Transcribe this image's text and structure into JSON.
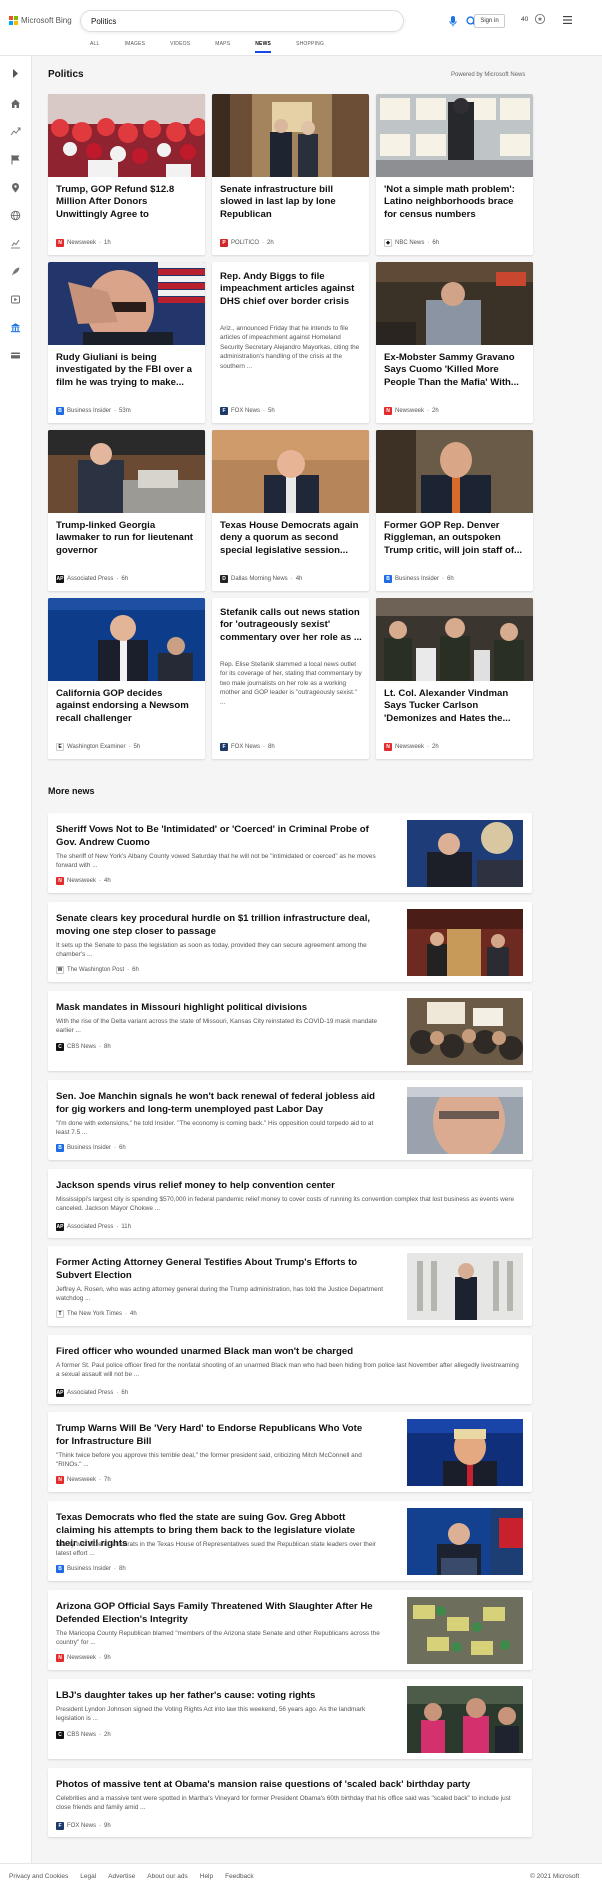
{
  "header": {
    "brand": "Microsoft Bing",
    "query": "Politics",
    "signin": "Sign in",
    "points": "40"
  },
  "nav": [
    "ALL",
    "IMAGES",
    "VIDEOS",
    "MAPS",
    "NEWS",
    "SHOPPING"
  ],
  "nav_active": "NEWS",
  "section": {
    "title": "Politics",
    "powered": "Powered by Microsoft News"
  },
  "cards": [
    {
      "title": "Trump, GOP Refund $12.8 Million After Donors Unwittingly Agree to Recurrin...",
      "source": "Newsweek",
      "time": "1h",
      "desc": ""
    },
    {
      "title": "Senate infrastructure bill slowed in last lap by lone Republican",
      "source": "POLITICO",
      "time": "2h",
      "desc": ""
    },
    {
      "title": "'Not a simple math problem': Latino neighborhoods brace for census numbers",
      "source": "NBC News",
      "time": "6h",
      "desc": ""
    },
    {
      "title": "Rudy Giuliani is being investigated by the FBI over a film he was trying to make...",
      "source": "Business Insider",
      "time": "53m",
      "desc": ""
    },
    {
      "title": "Rep. Andy Biggs to file impeachment articles against DHS chief over border crisis",
      "source": "FOX News",
      "time": "5h",
      "desc": "Ariz., announced Friday that he intends to file articles of impeachment against Homeland Security Secretary Alejandro Mayorkas, citing the administration's handling of the crisis at the southern ..."
    },
    {
      "title": "Ex-Mobster Sammy Gravano Says Cuomo 'Killed More People Than the Mafia' With...",
      "source": "Newsweek",
      "time": "2h",
      "desc": ""
    },
    {
      "title": "Trump-linked Georgia lawmaker to run for lieutenant governor",
      "source": "Associated Press",
      "time": "6h",
      "desc": ""
    },
    {
      "title": "Texas House Democrats again deny a quorum as second special legislative session...",
      "source": "Dallas Morning News",
      "time": "4h",
      "desc": ""
    },
    {
      "title": "Former GOP Rep. Denver Riggleman, an outspoken Trump critic, will join staff of...",
      "source": "Business Insider",
      "time": "6h",
      "desc": ""
    },
    {
      "title": "California GOP decides against endorsing a Newsom recall challenger",
      "source": "Washington Examiner",
      "time": "5h",
      "desc": ""
    },
    {
      "title": "Stefanik calls out news station for 'outrageously sexist' commentary over her role as ...",
      "source": "FOX News",
      "time": "8h",
      "desc": "Rep. Elise Stefanik slammed a local news outlet for its coverage of her, stating that commentary by two male journalists on her role as a working mother and GOP leader is \"outrageously sexist.\" ..."
    },
    {
      "title": "Lt. Col. Alexander Vindman Says Tucker Carlson 'Demonizes and Hates the...",
      "source": "Newsweek",
      "time": "2h",
      "desc": ""
    }
  ],
  "more_news_title": "More news",
  "more_news": [
    {
      "title": "Sheriff Vows Not to Be 'Intimidated' or 'Coerced' in Criminal Probe of Gov. Andrew Cuomo",
      "desc": "The sheriff of New York's Albany County vowed Saturday that he will not be \"intimidated or coerced\" as he moves forward with ...",
      "source": "Newsweek",
      "time": "4h"
    },
    {
      "title": "Senate clears key procedural hurdle on $1 trillion infrastructure deal, moving one step closer to passage",
      "desc": "It sets up the Senate to pass the legislation as soon as today, provided they can secure agreement among the chamber's ...",
      "source": "The Washington Post",
      "time": "6h"
    },
    {
      "title": "Mask mandates in Missouri highlight political divisions",
      "desc": "With the rise of the Delta variant across the state of Missouri, Kansas City reinstated its COVID-19 mask mandate earlier ...",
      "source": "CBS News",
      "time": "8h"
    },
    {
      "title": "Sen. Joe Manchin signals he won't back renewal of federal jobless aid for gig workers and long-term unemployed past Labor Day",
      "desc": "\"I'm done with extensions,\" he told Insider. \"The economy is coming back.\" His opposition could torpedo aid to at least 7.5 ...",
      "source": "Business Insider",
      "time": "6h"
    },
    {
      "title": "Jackson spends virus relief money to help convention center",
      "desc": "Mississippi's largest city is spending $570,000 in federal pandemic relief money to cover costs of running its convention complex that lost business as events were canceled. Jackson Mayor Chokwe ...",
      "source": "Associated Press",
      "time": "11h"
    },
    {
      "title": "Former Acting Attorney General Testifies About Trump's Efforts to Subvert Election",
      "desc": "Jeffrey A. Rosen, who was acting attorney general during the Trump administration, has told the Justice Department watchdog ...",
      "source": "The New York Times",
      "time": "4h"
    },
    {
      "title": "Fired officer who wounded unarmed Black man won't be charged",
      "desc": "A former St. Paul police officer fired for the nonfatal shooting of an unarmed Black man who had been hiding from police last November after allegedly livestreaming a sexual assault will not be ...",
      "source": "Associated Press",
      "time": "6h"
    },
    {
      "title": "Trump Warns Will Be 'Very Hard' to Endorse Republicans Who Vote for Infrastructure Bill",
      "desc": "\"Think twice before you approve this terrible deal,\" the former president said, criticizing Mitch McConnell and \"RINOs.\" ...",
      "source": "Newsweek",
      "time": "7h"
    },
    {
      "title": "Texas Democrats who fled the state are suing Gov. Greg Abbott claiming his attempts to bring them back to the legislature violate their civil rights",
      "desc": "Nearly two dozen Democrats in the Texas House of Representatives sued the Republican state leaders over their latest effort ...",
      "source": "Business Insider",
      "time": "8h"
    },
    {
      "title": "Arizona GOP Official Says Family Threatened With Slaughter After He Defended Election's Integrity",
      "desc": "The Maricopa County Republican blamed \"members of the Arizona state Senate and other Republicans across the country\" for ...",
      "source": "Newsweek",
      "time": "9h"
    },
    {
      "title": "LBJ's daughter takes up her father's cause: voting rights",
      "desc": "President Lyndon Johnson signed the Voting Rights Act into law this weekend, 56 years ago. As the landmark legislation is ...",
      "source": "CBS News",
      "time": "2h"
    },
    {
      "title": "Photos of massive tent at Obama's mansion raise questions of 'scaled back' birthday party",
      "desc": "Celebrities and a massive tent were spotted in Martha's Vineyard for former President Obama's 60th birthday that his office said was \"scaled back\" to include just close friends and family amid ...",
      "source": "FOX News",
      "time": "9h"
    }
  ],
  "footer": {
    "links": [
      "Privacy and Cookies",
      "Legal",
      "Advertise",
      "About our ads",
      "Help",
      "Feedback"
    ],
    "copyright": "© 2021 Microsoft"
  },
  "colors": {
    "accent": "#174ae4",
    "bing_blue": "#1a73e8"
  }
}
